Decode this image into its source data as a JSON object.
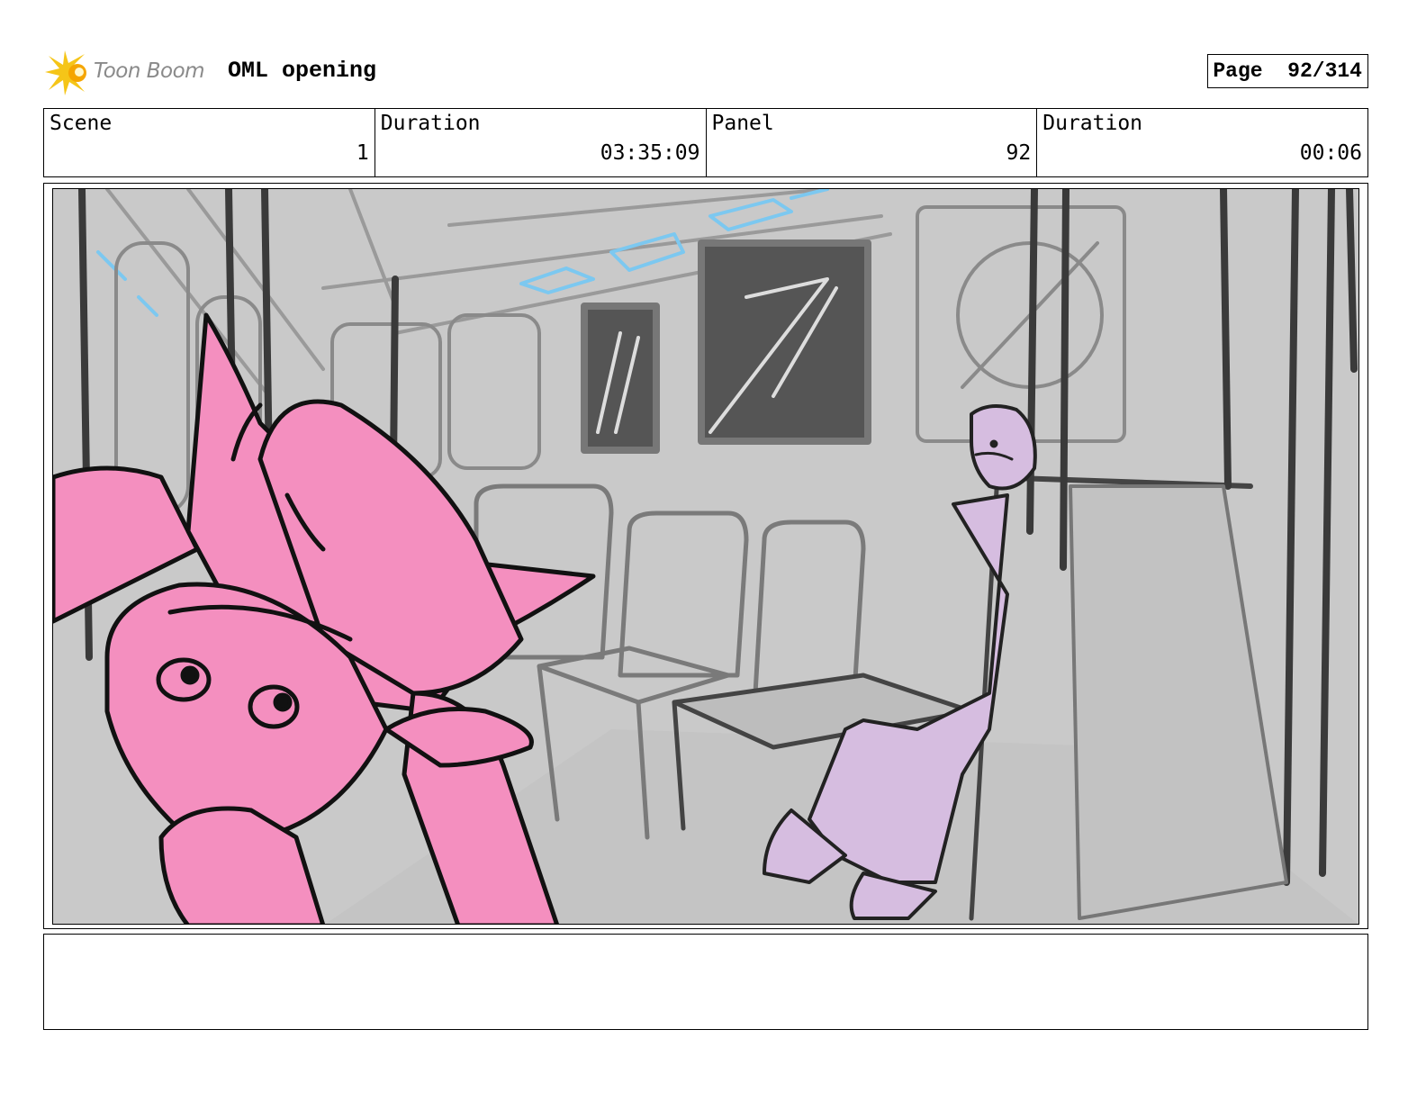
{
  "header": {
    "logo_text": "Toon Boom",
    "project_title": "OML opening",
    "page_label": "Page",
    "page_number": "92/314"
  },
  "info": {
    "scene_label": "Scene",
    "scene_value": "1",
    "scene_duration_label": "Duration",
    "scene_duration_value": "03:35:09",
    "panel_label": "Panel",
    "panel_value": "92",
    "panel_duration_label": "Duration",
    "panel_duration_value": "00:06"
  },
  "colors": {
    "logo_accent": "#f5c518",
    "sketch_pink": "#f48fbf",
    "sketch_lavender": "#d6bde0",
    "sketch_blue": "#7cc8f0",
    "background_gray": "#c9c9c9"
  },
  "icons": {
    "logo": "toon-boom-star-icon"
  }
}
